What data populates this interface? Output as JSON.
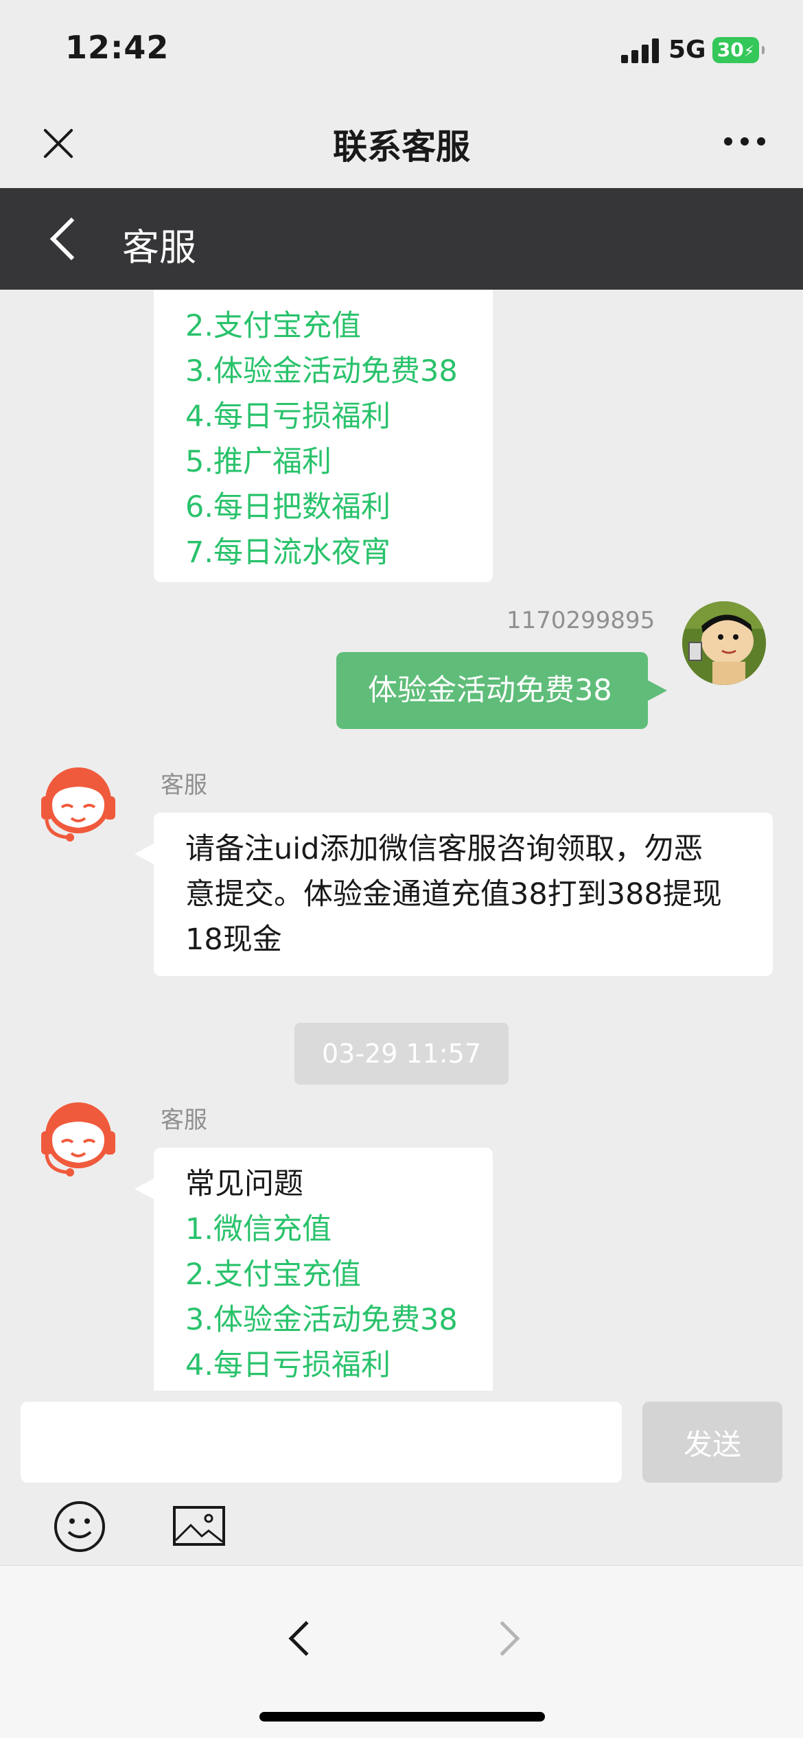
{
  "status_bar": {
    "time": "12:42",
    "network": "5G",
    "battery": "30"
  },
  "title_bar": {
    "title": "联系客服"
  },
  "chat_header": {
    "title": "客服"
  },
  "messages": {
    "menu_top": {
      "links": [
        "2.支付宝充值",
        "3.体验金活动免费38",
        "4.每日亏损福利",
        "5.推广福利",
        "6.每日把数福利",
        "7.每日流水夜宵"
      ]
    },
    "user_message": {
      "sender": "1170299895",
      "text": "体验金活动免费38"
    },
    "agent_reply": {
      "sender": "客服",
      "lines": [
        "请备注uid添加微信客服咨询领取，勿恶",
        "意提交。体验金通道充值38打到388提现",
        "18现金"
      ]
    },
    "timestamp": "03-29 11:57",
    "menu_bottom": {
      "sender": "客服",
      "heading": "常见问题",
      "links": [
        "1.微信充值",
        "2.支付宝充值",
        "3.体验金活动免费38",
        "4.每日亏损福利"
      ]
    }
  },
  "input": {
    "value": "",
    "send_label": "发送"
  },
  "colors": {
    "link_green": "#29c26b",
    "user_bubble": "#5fbd79",
    "agent_avatar": "#f05a3c",
    "dark_header": "#363638"
  },
  "icons": [
    "close-icon",
    "more-icon",
    "back-icon",
    "emoji-icon",
    "image-icon",
    "nav-back-icon",
    "nav-forward-icon"
  ]
}
